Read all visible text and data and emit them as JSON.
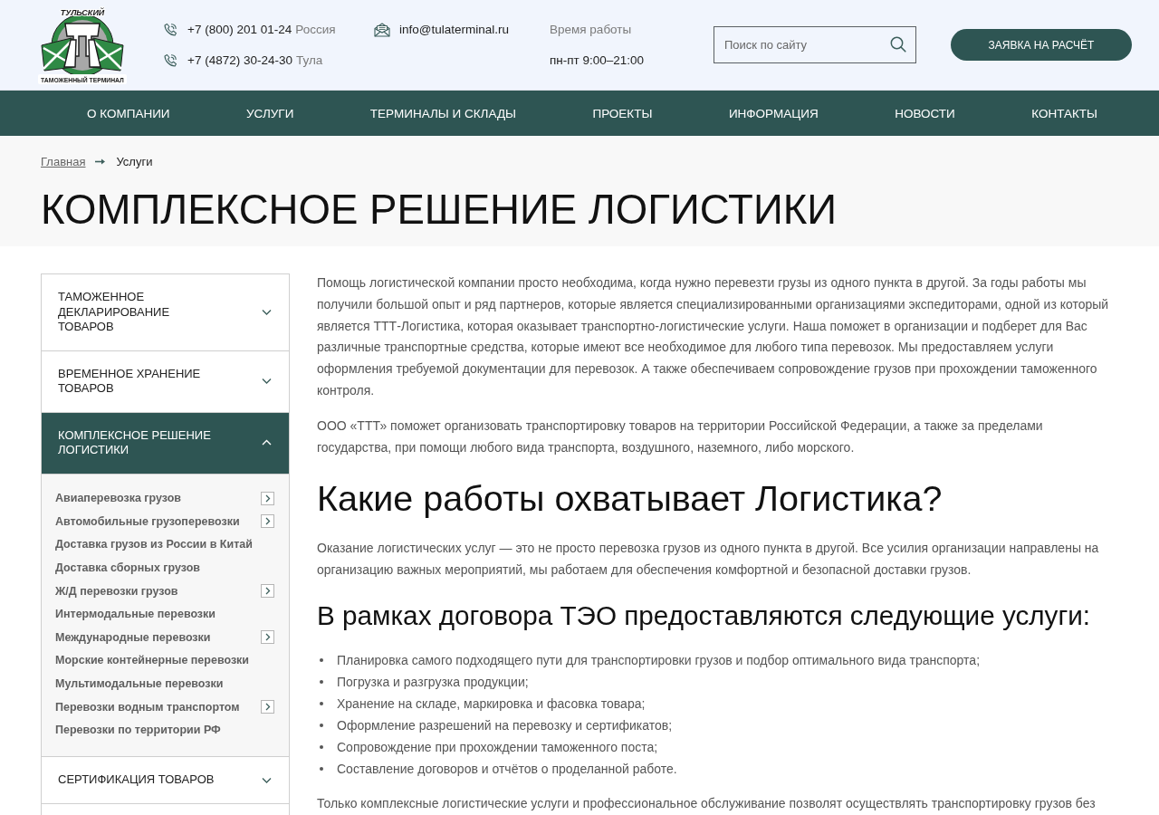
{
  "header": {
    "logo": {
      "top_text": "ТУЛЬСКИЙ",
      "bottom_text": "ТАМОЖЕННЫЙ ТЕРМИНАЛ"
    },
    "phones": [
      {
        "number": "+7 (800) 201 01-24",
        "city": "Россия"
      },
      {
        "number": "+7 (4872) 30-24-30",
        "city": "Тула"
      }
    ],
    "email": "info@tulaterminal.ru",
    "hours": {
      "label": "Время работы",
      "value": "пн-пт 9:00–21:00"
    },
    "search": {
      "placeholder": "Поиск по сайту"
    },
    "cta_button": "ЗАЯВКА НА РАСЧЁТ"
  },
  "nav": {
    "items": [
      "О КОМПАНИИ",
      "УСЛУГИ",
      "ТЕРМИНАЛЫ И СКЛАДЫ",
      "ПРОЕКТЫ",
      "ИНФОРМАЦИЯ",
      "НОВОСТИ",
      "КОНТАКТЫ"
    ]
  },
  "breadcrumb": [
    {
      "kind": "link",
      "label": "Главная"
    },
    {
      "kind": "current",
      "label": "Услуги"
    }
  ],
  "title": "КОМПЛЕКСНОЕ РЕШЕНИЕ ЛОГИСТИКИ",
  "sidebar": {
    "items": [
      {
        "label": "ТАМОЖЕННОЕ ДЕКЛАРИРОВАНИЕ ТОВАРОВ",
        "expanded": false
      },
      {
        "label": "ВРЕМЕННОЕ ХРАНЕНИЕ ТОВАРОВ",
        "expanded": false
      },
      {
        "label": "КОМПЛЕКСНОЕ РЕШЕНИЕ ЛОГИСТИКИ",
        "expanded": true,
        "children": [
          {
            "label": "Авиаперевозка грузов",
            "has_submenu": true
          },
          {
            "label": "Автомобильные грузоперевозки",
            "has_submenu": true
          },
          {
            "label": "Доставка грузов из России в Китай",
            "has_submenu": false
          },
          {
            "label": "Доставка сборных грузов",
            "has_submenu": false
          },
          {
            "label": "Ж/Д перевозки грузов",
            "has_submenu": true
          },
          {
            "label": "Интермодальные перевозки",
            "has_submenu": false
          },
          {
            "label": "Международные перевозки",
            "has_submenu": true
          },
          {
            "label": "Морские контейнерные перевозки",
            "has_submenu": false
          },
          {
            "label": "Мультимодальные перевозки",
            "has_submenu": false
          },
          {
            "label": "Перевозки водным транспортом",
            "has_submenu": true
          },
          {
            "label": "Перевозки по территории РФ",
            "has_submenu": false
          }
        ]
      },
      {
        "label": "СЕРТИФИКАЦИЯ ТОВАРОВ",
        "expanded": false
      }
    ]
  },
  "content": {
    "blocks": [
      {
        "kind": "paragraph",
        "text": "Помощь логистической компании просто необходима, когда нужно перевезти грузы из одного пункта в другой. За годы работы мы получили большой опыт и ряд партнеров, которые является специализированными организациями экспедиторами, одной из который является ТТТ-Логистика, которая оказывает транспортно-логистические услуги. Наша поможет в организации и подберет для Вас различные транспортные средства, которые имеют все необходимое для любого типа перевозок. Мы предоставляем услуги оформления требуемой документации для перевозок. А также обеспечиваем сопровождение грузов при прохождении таможенного контроля."
      },
      {
        "kind": "paragraph",
        "text": "ООО «ТТТ» поможет организовать транспортировку товаров на территории Российской Федерации, а также за пределами государства, при помощи любого вида транспорта, воздушного, наземного, либо морского."
      },
      {
        "kind": "heading",
        "text": "Какие работы охватывает Логистика?"
      },
      {
        "kind": "paragraph",
        "text": "Оказание логистических услуг — это не просто перевозка грузов из одного пункта в другой. Все усилия организации направлены на организацию важных мероприятий, мы работаем для обеспечения комфортной и безопасной доставки грузов."
      },
      {
        "kind": "subheading",
        "text": "В рамках договора ТЭО предоставляются следующие услуги:"
      },
      {
        "kind": "list",
        "items": [
          "Планировка самого подходящего пути для транспортировки грузов и подбор оптимального вида транспорта;",
          "Погрузка и разгрузка продукции;",
          "Хранение на складе, маркировка и фасовка товара;",
          "Оформление разрешений на перевозку и сертификатов;",
          "Сопровождение при прохождении таможенного поста;",
          "Составление договоров и отчётов о проделанной работе."
        ]
      },
      {
        "kind": "paragraph",
        "text": "Только комплексные логистические услуги и профессиональное обслуживание позволят осуществлять транспортировку грузов без"
      }
    ]
  }
}
